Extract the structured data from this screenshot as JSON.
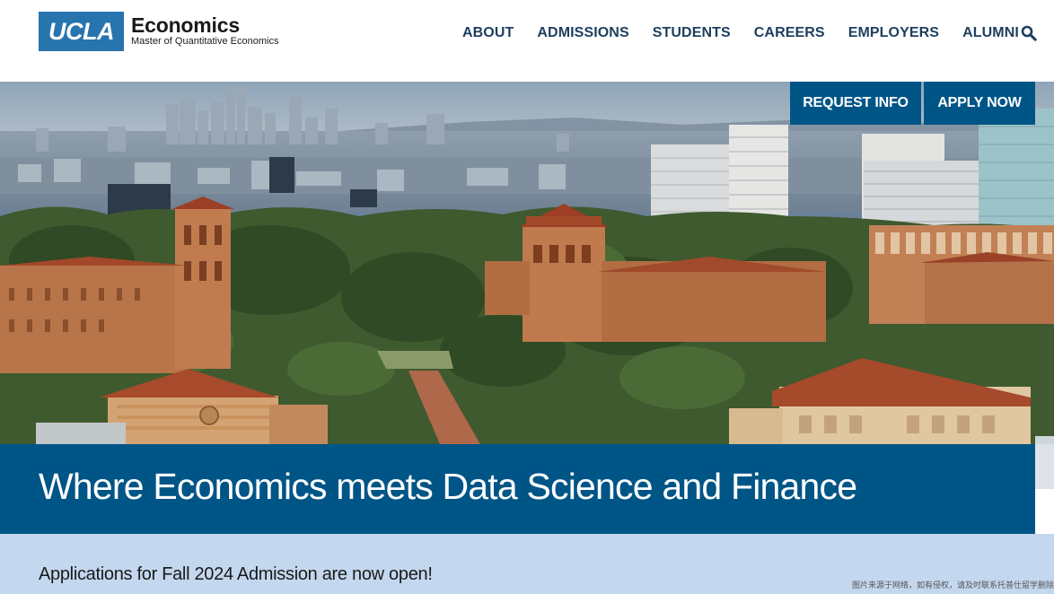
{
  "header": {
    "logo_text": "UCLA",
    "department": "Economics",
    "program": "Master of Quantitative Economics"
  },
  "nav": {
    "items": [
      {
        "label": "ABOUT"
      },
      {
        "label": "ADMISSIONS"
      },
      {
        "label": "STUDENTS"
      },
      {
        "label": "CAREERS"
      },
      {
        "label": "EMPLOYERS"
      },
      {
        "label": "ALUMNI"
      }
    ],
    "search_icon": "search-icon"
  },
  "hero": {
    "image": "campus-skyline-photo",
    "request_info_label": "REQUEST INFO",
    "apply_now_label": "APPLY NOW"
  },
  "tagline": "Where Economics meets Data Science and Finance",
  "announcement": "Applications for Fall 2024 Admission are now open!",
  "watermark": "图片来源于网络，如有侵权，请及时联系托普仕留学删除",
  "colors": {
    "brand_blue": "#2774ae",
    "dark_blue": "#005587",
    "nav_text": "#1e3e5f",
    "light_blue_band": "#c3d7ee"
  }
}
